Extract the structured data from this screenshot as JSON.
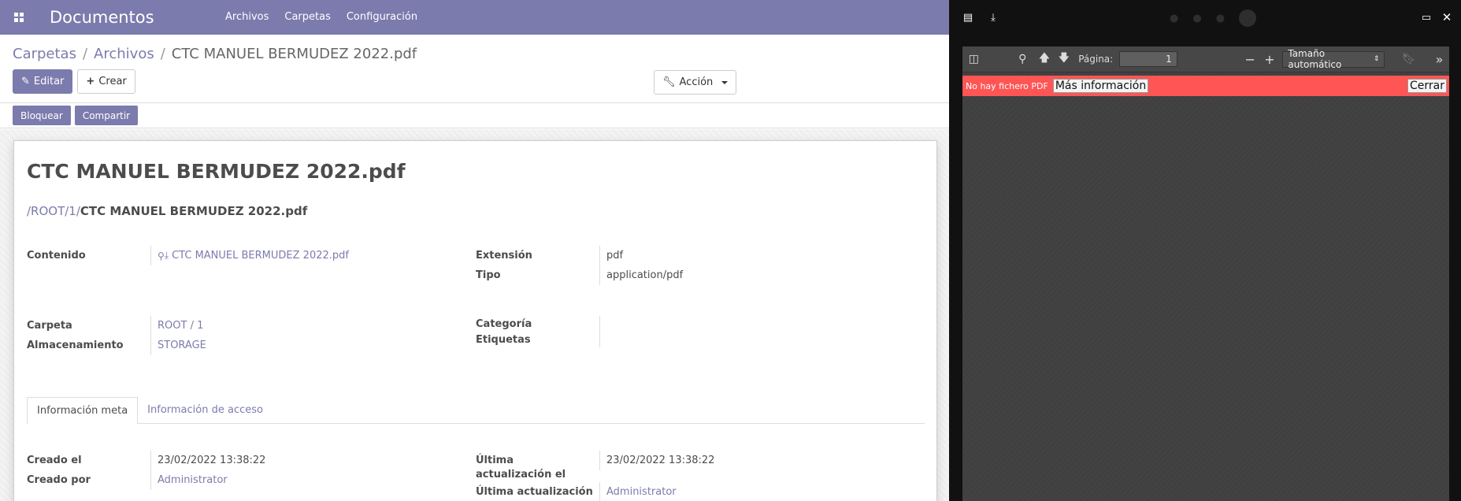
{
  "navbar": {
    "brand": "Documentos",
    "menu": [
      "Archivos",
      "Carpetas",
      "Configuración"
    ]
  },
  "breadcrumb": {
    "items": [
      "Carpetas",
      "Archivos"
    ],
    "current": "CTC MANUEL BERMUDEZ 2022.pdf",
    "separator": "/"
  },
  "buttons": {
    "edit": "Editar",
    "create": "Crear",
    "action": "Acción",
    "lock": "Bloquear",
    "share": "Compartir"
  },
  "record": {
    "title": "CTC MANUEL BERMUDEZ 2022.pdf",
    "path_root": "/ROOT/1/",
    "path_name": "CTC MANUEL BERMUDEZ 2022.pdf",
    "fields": {
      "content_label": "Contenido",
      "content_value": "CTC MANUEL BERMUDEZ 2022.pdf",
      "extension_label": "Extensión",
      "extension_value": "pdf",
      "type_label": "Tipo",
      "type_value": "application/pdf",
      "folder_label": "Carpeta",
      "folder_value": "ROOT / 1",
      "storage_label": "Almacenamiento",
      "storage_value": "STORAGE",
      "category_label": "Categoría",
      "tags_label": "Etiquetas"
    }
  },
  "tabs": [
    "Información meta",
    "Información de acceso"
  ],
  "meta": {
    "created_on_label": "Creado el",
    "created_on_value": "23/02/2022 13:38:22",
    "created_by_label": "Creado por",
    "created_by_value": "Administrator",
    "updated_on_label": "Última actualización el",
    "updated_on_value": "23/02/2022 13:38:22",
    "updated_by_label": "Última actualización",
    "updated_by_value": "Administrator"
  },
  "viewer": {
    "page_label": "Página:",
    "page_value": "1",
    "zoom": "Tamaño automático",
    "error_text": "No hay fichero PDF",
    "more_info": "Más información",
    "close": "Cerrar"
  },
  "colors": {
    "brand": "#7c7bad",
    "error": "#ff5555"
  }
}
